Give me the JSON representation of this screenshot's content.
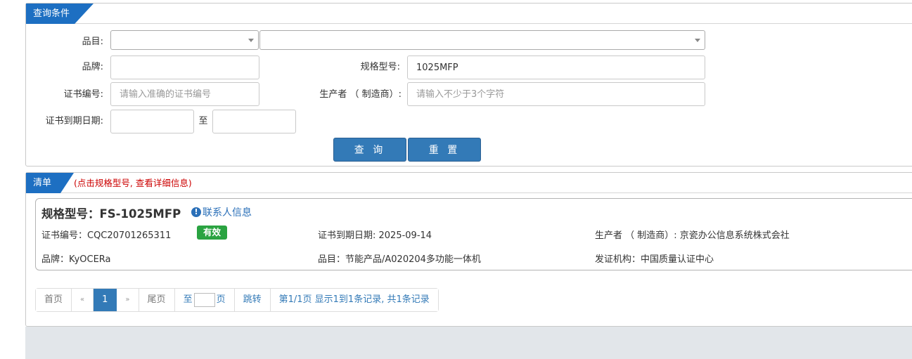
{
  "query": {
    "tab_label": "查询条件",
    "category_label": "品目:",
    "brand_label": "品牌:",
    "brand_value": "",
    "model_label": "规格型号:",
    "model_value": "1025MFP",
    "cert_no_label": "证书编号:",
    "cert_no_placeholder": "请输入准确的证书编号",
    "producer_label": "生产者 （ 制造商）:",
    "producer_placeholder": "请输入不少于3个字符",
    "expiry_label": "证书到期日期:",
    "to_label": "至",
    "search_button": "查 询",
    "reset_button": "重 置"
  },
  "list": {
    "tab_label": "清单",
    "hint": "(点击规格型号, 查看详细信息)",
    "items": [
      {
        "model": "规格型号：FS-1025MFP",
        "contact_link": "联系人信息",
        "cert_no": "证书编号：CQC20701265311",
        "status": "有效",
        "expiry": "证书到期日期: 2025-09-14",
        "producer": "生产者 （ 制造商）: 京瓷办公信息系统株式会社",
        "brand": "品牌：KyOCERa",
        "category": "品目：节能产品/A020204多功能一体机",
        "issuer": "发证机构：中国质量认证中心"
      }
    ]
  },
  "pagination": {
    "first": "首页",
    "prev": "«",
    "current": "1",
    "next": "»",
    "last": "尾页",
    "goto_prefix": "至",
    "goto_suffix": "页",
    "jump": "跳转",
    "summary": "第1/1页  显示1到1条记录, 共1条记录"
  },
  "colors": {
    "accent": "#1d6fc2",
    "button": "#337ab7",
    "status_valid": "#2aa341",
    "hint": "#cc0000"
  }
}
